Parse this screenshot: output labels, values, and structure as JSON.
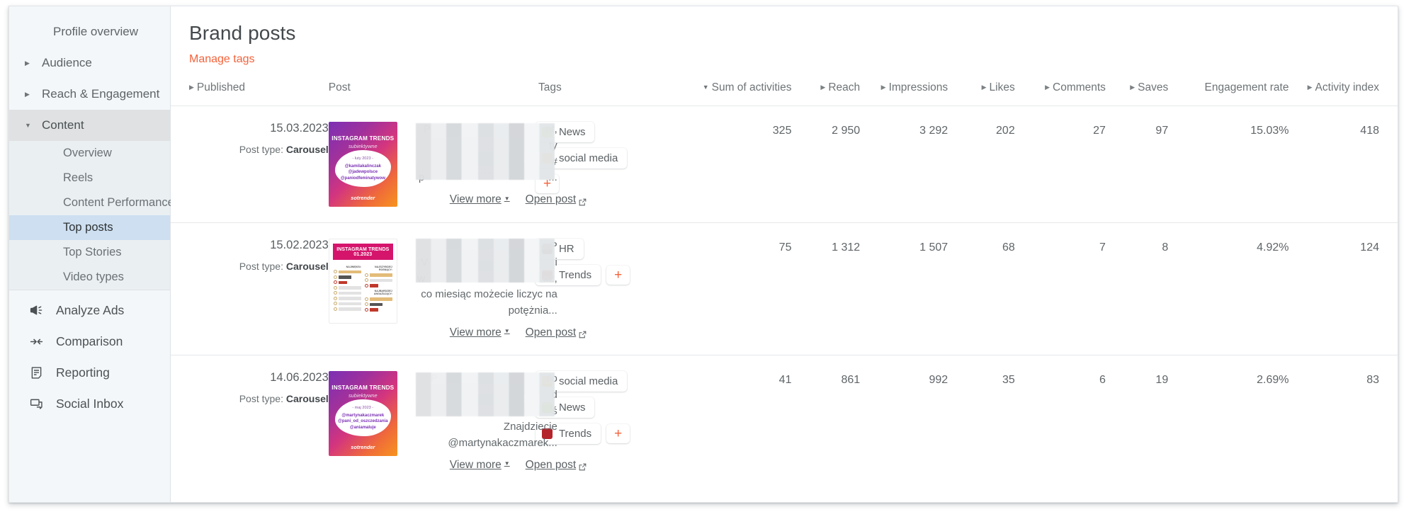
{
  "sidebar": {
    "items": [
      {
        "label": "Profile overview",
        "caret": "none",
        "level": 1
      },
      {
        "label": "Audience",
        "caret": "collapsed",
        "level": 1
      },
      {
        "label": "Reach & Engagement",
        "caret": "collapsed",
        "level": 1
      },
      {
        "label": "Content",
        "caret": "expanded",
        "level": 1
      }
    ],
    "content_children": [
      {
        "label": "Overview",
        "active": false
      },
      {
        "label": "Reels",
        "active": false
      },
      {
        "label": "Content Performance",
        "active": false
      },
      {
        "label": "Top posts",
        "active": true
      },
      {
        "label": "Top Stories",
        "active": false
      },
      {
        "label": "Video types",
        "active": false
      }
    ],
    "bottom_items": [
      {
        "label": "Analyze Ads",
        "icon": "megaphone-icon"
      },
      {
        "label": "Comparison",
        "icon": "compare-arrows-icon"
      },
      {
        "label": "Reporting",
        "icon": "document-icon"
      },
      {
        "label": "Social Inbox",
        "icon": "chat-bubbles-icon"
      }
    ]
  },
  "header": {
    "title": "Brand posts",
    "manage_tags_label": "Manage tags",
    "manage_tags_color": "#f4623a"
  },
  "table": {
    "columns": [
      {
        "key": "published",
        "label": "Published",
        "sort": "asc",
        "align": "left"
      },
      {
        "key": "post",
        "label": "Post",
        "sort": "none",
        "align": "left"
      },
      {
        "key": "tags",
        "label": "Tags",
        "sort": "none",
        "align": "left"
      },
      {
        "key": "sum",
        "label": "Sum of activities",
        "sort": "desc",
        "align": "right"
      },
      {
        "key": "reach",
        "label": "Reach",
        "sort": "asc",
        "align": "right"
      },
      {
        "key": "impressions",
        "label": "Impressions",
        "sort": "asc",
        "align": "right"
      },
      {
        "key": "likes",
        "label": "Likes",
        "sort": "asc",
        "align": "right"
      },
      {
        "key": "comments",
        "label": "Comments",
        "sort": "asc",
        "align": "right"
      },
      {
        "key": "saves",
        "label": "Saves",
        "sort": "asc",
        "align": "right"
      },
      {
        "key": "engagement",
        "label": "Engagement rate",
        "sort": "none",
        "align": "right"
      },
      {
        "key": "activity",
        "label": "Activity index",
        "sort": "asc",
        "align": "right"
      }
    ],
    "post_type_label": "Post type:",
    "view_more_label": "View more",
    "open_post_label": "Open post",
    "rows": [
      {
        "date": "15.03.2023",
        "post_type": "Carousel",
        "thumb": {
          "style": "gradient",
          "title": "INSTAGRAM TRENDS",
          "subtitle": "subiektywne",
          "date_badge": "- luty 2023 -",
          "handles": [
            "@kamilakalinczak",
            "@jadewpolsce",
            "@paniodfeminatywow"
          ],
          "brand": "sotrender"
        },
        "text_visible": "P                                       et,\nty\n#\np                                          ...",
        "tags": [
          {
            "label": "News",
            "color": "#8bc617"
          },
          {
            "label": "social media",
            "color": "#f0a400"
          }
        ],
        "sum": "325",
        "reach": "2 950",
        "impressions": "3 292",
        "likes": "202",
        "comments": "27",
        "saves": "97",
        "engagement": "15.03%",
        "activity": "418"
      },
      {
        "date": "15.02.2023",
        "post_type": "Carousel",
        "thumb": {
          "style": "white",
          "title": "INSTAGRAM TRENDS 01.2023",
          "col1_head": "NAJWIĘKSI:",
          "col2_head": "NAJSZYBCIEJ ROSNĄCY:",
          "col3_head": "NAJBARDZIEJ ANGAŻUJĄCY:"
        },
        "text_visible": "P\nV                                           i\nw                                        az,\nco miesiąc możecie liczyc na potężnia...",
        "tags": [
          {
            "label": "HR",
            "color": "#6b2f35"
          },
          {
            "label": "Trends",
            "color": "#b5232b"
          }
        ],
        "sum": "75",
        "reach": "1 312",
        "impressions": "1 507",
        "likes": "68",
        "comments": "7",
        "saves": "8",
        "engagement": "4.92%",
        "activity": "124"
      },
      {
        "date": "14.06.2023",
        "post_type": "Carousel",
        "thumb": {
          "style": "gradient",
          "title": "INSTAGRAM TRENDS",
          "subtitle": "subiektywne",
          "date_badge": "- maj 2023 -",
          "handles": [
            "@martynakaczmarek",
            "@pani_od_oszczedzania",
            "@aniamaluje"
          ],
          "brand": "sotrender"
        },
        "text_visible": "P                                     ilo\nd\nś\nZnajdziecie    @martynakaczmarek...",
        "tags": [
          {
            "label": "social media",
            "color": "#f0a400"
          },
          {
            "label": "News",
            "color": "#8bc617"
          },
          {
            "label": "Trends",
            "color": "#b5232b"
          }
        ],
        "sum": "41",
        "reach": "861",
        "impressions": "992",
        "likes": "35",
        "comments": "6",
        "saves": "19",
        "engagement": "2.69%",
        "activity": "83"
      }
    ],
    "add_tag_label": "+"
  }
}
